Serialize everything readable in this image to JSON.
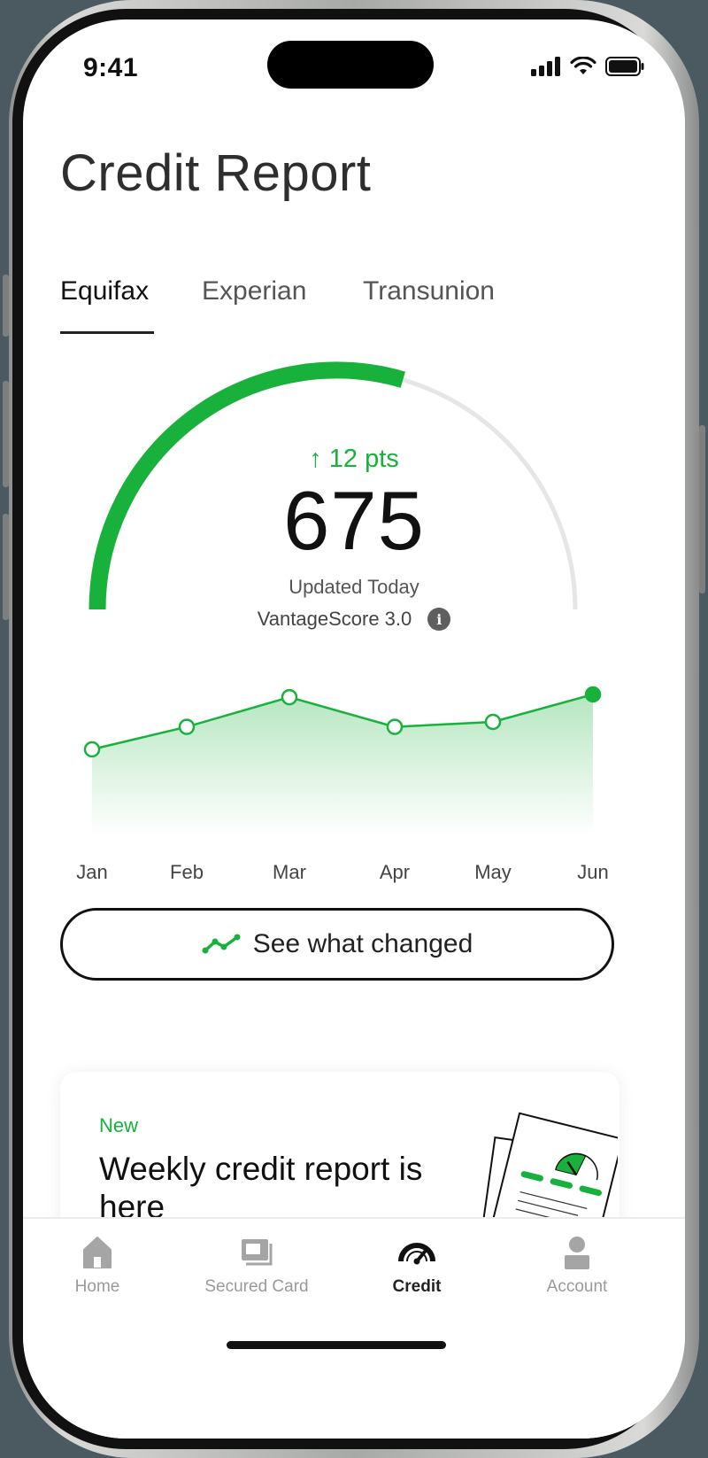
{
  "status_bar": {
    "time": "9:41"
  },
  "page": {
    "title": "Credit Report"
  },
  "tabs": [
    {
      "label": "Equifax",
      "active": true
    },
    {
      "label": "Experian",
      "active": false
    },
    {
      "label": "Transunion",
      "active": false
    }
  ],
  "score": {
    "change": "↑ 12 pts",
    "value": "675",
    "updated": "Updated Today",
    "model": "VantageScore 3.0",
    "gauge_fill_fraction": 0.59
  },
  "trend": {
    "months": [
      "Jan",
      "Feb",
      "Mar",
      "Apr",
      "May",
      "Jun"
    ],
    "relative_levels": [
      0.0,
      0.41,
      0.95,
      0.41,
      0.5,
      1.0
    ]
  },
  "cta": {
    "label": "See what changed"
  },
  "promo": {
    "badge": "New",
    "title": "Weekly credit report is here"
  },
  "tab_bar": {
    "items": [
      {
        "label": "Home",
        "icon": "home-icon",
        "active": false
      },
      {
        "label": "Secured Card",
        "icon": "card-icon",
        "active": false
      },
      {
        "label": "Credit",
        "icon": "gauge-icon",
        "active": true
      },
      {
        "label": "Account",
        "icon": "person-icon",
        "active": false
      }
    ]
  },
  "colors": {
    "accent": "#18b13b",
    "track": "#e6e6e6",
    "text_primary": "#111111",
    "text_muted": "#9a9a9a"
  }
}
